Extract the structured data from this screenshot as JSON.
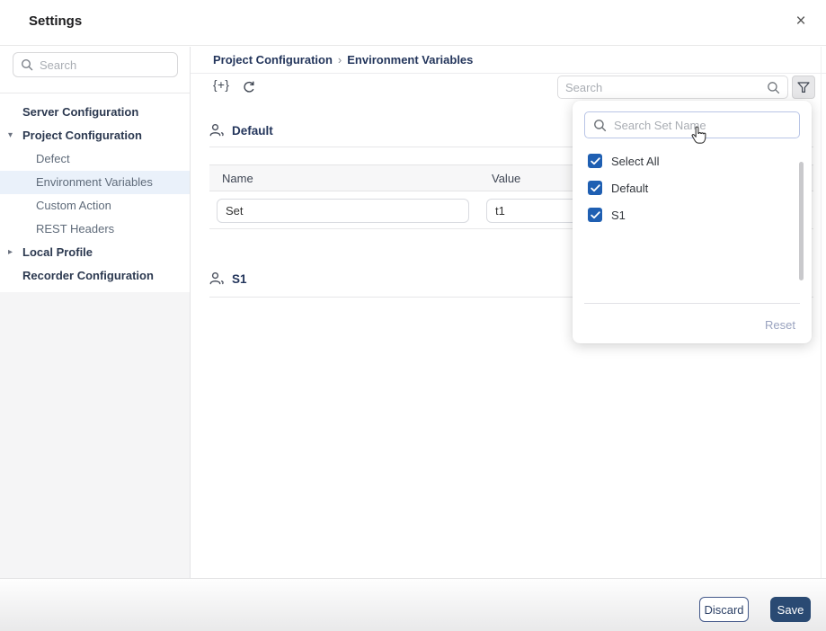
{
  "dialog": {
    "title": "Settings"
  },
  "icons": {
    "close": "×",
    "caret_down": "▾",
    "caret_right": "▸",
    "add_variable": "{+}",
    "breadcrumb_separator": "›"
  },
  "sidebar": {
    "search_placeholder": "Search",
    "items": [
      {
        "label": "Server Configuration"
      },
      {
        "label": "Project Configuration"
      },
      {
        "label": "Defect"
      },
      {
        "label": "Environment Variables"
      },
      {
        "label": "Custom Action"
      },
      {
        "label": "REST Headers"
      },
      {
        "label": "Local Profile"
      },
      {
        "label": "Recorder Configuration"
      }
    ]
  },
  "breadcrumb": {
    "parent": "Project Configuration",
    "current": "Environment Variables"
  },
  "toolbar": {
    "search_placeholder": "Search"
  },
  "filter_dropdown": {
    "search_placeholder": "Search Set Name",
    "options": [
      {
        "label": "Select All",
        "checked": true
      },
      {
        "label": "Default",
        "checked": true
      },
      {
        "label": "S1",
        "checked": true
      }
    ],
    "reset_label": "Reset"
  },
  "sections": {
    "default": {
      "title": "Default",
      "columns": [
        "Name",
        "Value"
      ],
      "row": {
        "name": "Set",
        "value": "t1"
      }
    },
    "s1": {
      "title": "S1"
    }
  },
  "footer": {
    "discard": "Discard",
    "save": "Save"
  },
  "colors": {
    "accent_navy": "#2a4a73",
    "checkbox_blue": "#1f5fb2",
    "selected_item_bg": "#eaf1fa",
    "breadcrumb_text": "#24365c"
  }
}
